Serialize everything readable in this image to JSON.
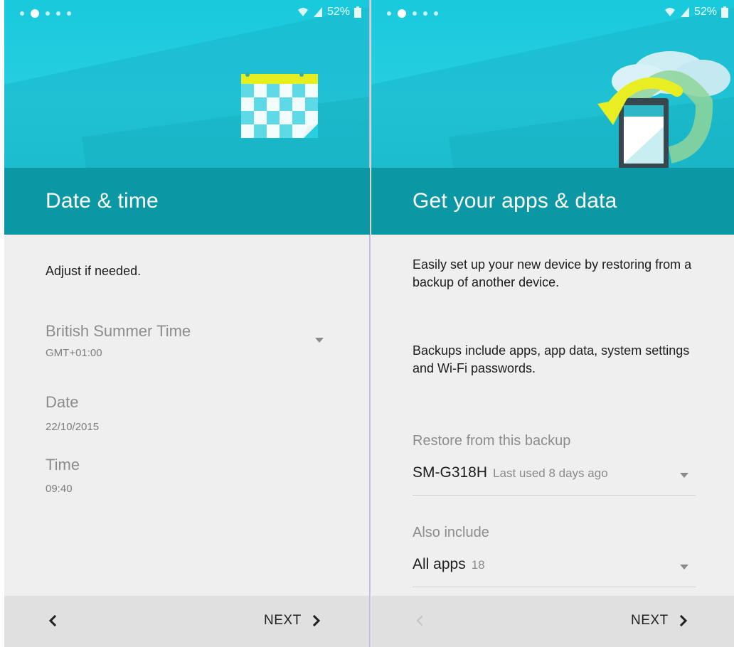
{
  "status": {
    "battery_left": "52%",
    "battery_right": "52%"
  },
  "date_time_screen": {
    "title": "Date & time",
    "instruction": "Adjust if needed.",
    "timezone": {
      "name": "British Summer Time",
      "offset": "GMT+01:00"
    },
    "date": {
      "label": "Date",
      "value": "22/10/2015"
    },
    "time": {
      "label": "Time",
      "value": "09:40"
    },
    "next_label": "NEXT",
    "icons": [
      "calendar-illustration",
      "back-chevron-icon",
      "next-chevron-icon",
      "dropdown-arrow-icon"
    ]
  },
  "apps_data_screen": {
    "title": "Get your apps & data",
    "description": "Easily set up your new device by restoring from a backup of another device.",
    "backups_info": "Backups include apps, app data, system settings and Wi-Fi passwords.",
    "restore": {
      "label": "Restore from this backup",
      "device": "SM-G318H",
      "last_used": "Last used 8 days ago"
    },
    "include": {
      "label": "Also include",
      "value": "All apps",
      "count": "18"
    },
    "next_label": "NEXT",
    "icons": [
      "cloud-restore-illustration",
      "back-chevron-icon",
      "next-chevron-icon",
      "dropdown-arrow-icon"
    ]
  },
  "colors": {
    "hero_cyan": "#22cbdd",
    "title_teal": "#0b98a4",
    "content_bg": "#efefef",
    "bottom_bar": "#e0e0e0",
    "calendar_yellow": "#e8ee22"
  }
}
